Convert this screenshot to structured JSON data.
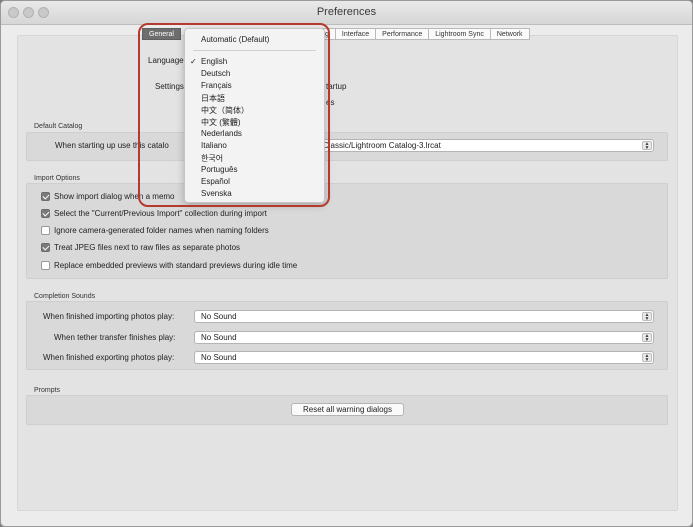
{
  "window": {
    "title": "Preferences"
  },
  "tabs": {
    "left": [
      "General"
    ],
    "right": [
      "ling",
      "Interface",
      "Performance",
      "Lightroom Sync",
      "Network"
    ]
  },
  "general": {
    "language_label": "Language",
    "settings_label": "Settings:",
    "startup_text": "tartup",
    "es_text": "es"
  },
  "language_menu": {
    "items": [
      "Automatic (Default)",
      "English",
      "Deutsch",
      "Français",
      "日本語",
      "中文（简体）",
      "中文 (繁體)",
      "Nederlands",
      "Italiano",
      "한국어",
      "Português",
      "Español",
      "Svenska"
    ],
    "selected": "English",
    "check": "✓"
  },
  "default_catalog": {
    "section": "Default Catalog",
    "label": "When starting up use this catalo",
    "value": "Classic/Lightroom Catalog-3.lrcat"
  },
  "import_options": {
    "section": "Import Options",
    "items": [
      {
        "label": "Show import dialog when a memo",
        "checked": true
      },
      {
        "label": "Select the \"Current/Previous Import\" collection during import",
        "checked": true
      },
      {
        "label": "Ignore camera-generated folder names when naming folders",
        "checked": false
      },
      {
        "label": "Treat JPEG files next to raw files as separate photos",
        "checked": true
      },
      {
        "label": "Replace embedded previews with standard previews during idle time",
        "checked": false
      }
    ]
  },
  "completion_sounds": {
    "section": "Completion Sounds",
    "rows": [
      {
        "label": "When finished importing photos play:",
        "value": "No Sound"
      },
      {
        "label": "When tether transfer finishes play:",
        "value": "No Sound"
      },
      {
        "label": "When finished exporting photos play:",
        "value": "No Sound"
      }
    ]
  },
  "prompts": {
    "section": "Prompts",
    "reset_button": "Reset all warning dialogs"
  },
  "icons": {
    "stepper": "updown-chevron-icon",
    "check": "checkmark-icon"
  }
}
